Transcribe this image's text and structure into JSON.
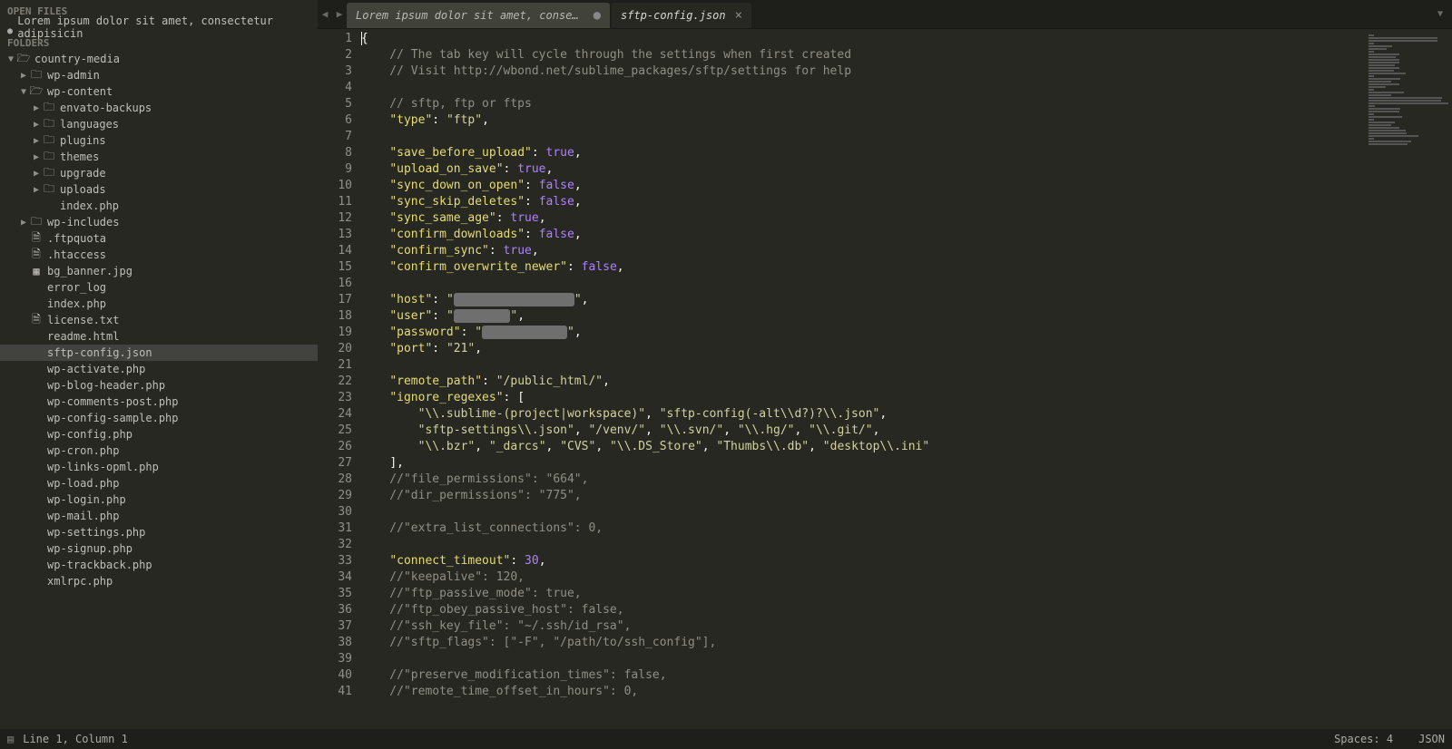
{
  "sidebar": {
    "openFilesLabel": "OPEN FILES",
    "openFiles": [
      {
        "name": "Lorem ipsum dolor sit amet, consectetur adipisicin",
        "dirty": true
      }
    ],
    "foldersLabel": "FOLDERS",
    "tree": [
      {
        "depth": 0,
        "twisty": "open",
        "icon": "folder-open",
        "name": "country-media"
      },
      {
        "depth": 1,
        "twisty": "closed",
        "icon": "folder",
        "name": "wp-admin"
      },
      {
        "depth": 1,
        "twisty": "open",
        "icon": "folder-open",
        "name": "wp-content"
      },
      {
        "depth": 2,
        "twisty": "closed",
        "icon": "folder",
        "name": "envato-backups"
      },
      {
        "depth": 2,
        "twisty": "closed",
        "icon": "folder",
        "name": "languages"
      },
      {
        "depth": 2,
        "twisty": "closed",
        "icon": "folder",
        "name": "plugins"
      },
      {
        "depth": 2,
        "twisty": "closed",
        "icon": "folder",
        "name": "themes"
      },
      {
        "depth": 2,
        "twisty": "closed",
        "icon": "folder",
        "name": "upgrade"
      },
      {
        "depth": 2,
        "twisty": "closed",
        "icon": "folder",
        "name": "uploads"
      },
      {
        "depth": 2,
        "twisty": "none",
        "icon": "none",
        "name": "index.php"
      },
      {
        "depth": 1,
        "twisty": "closed",
        "icon": "folder",
        "name": "wp-includes"
      },
      {
        "depth": 1,
        "twisty": "none",
        "icon": "file",
        "name": ".ftpquota"
      },
      {
        "depth": 1,
        "twisty": "none",
        "icon": "file",
        "name": ".htaccess"
      },
      {
        "depth": 1,
        "twisty": "none",
        "icon": "image",
        "name": "bg_banner.jpg"
      },
      {
        "depth": 1,
        "twisty": "none",
        "icon": "none",
        "name": "error_log"
      },
      {
        "depth": 1,
        "twisty": "none",
        "icon": "none",
        "name": "index.php"
      },
      {
        "depth": 1,
        "twisty": "none",
        "icon": "file",
        "name": "license.txt"
      },
      {
        "depth": 1,
        "twisty": "none",
        "icon": "none",
        "name": "readme.html"
      },
      {
        "depth": 1,
        "twisty": "none",
        "icon": "none",
        "name": "sftp-config.json",
        "selected": true
      },
      {
        "depth": 1,
        "twisty": "none",
        "icon": "none",
        "name": "wp-activate.php"
      },
      {
        "depth": 1,
        "twisty": "none",
        "icon": "none",
        "name": "wp-blog-header.php"
      },
      {
        "depth": 1,
        "twisty": "none",
        "icon": "none",
        "name": "wp-comments-post.php"
      },
      {
        "depth": 1,
        "twisty": "none",
        "icon": "none",
        "name": "wp-config-sample.php"
      },
      {
        "depth": 1,
        "twisty": "none",
        "icon": "none",
        "name": "wp-config.php"
      },
      {
        "depth": 1,
        "twisty": "none",
        "icon": "none",
        "name": "wp-cron.php"
      },
      {
        "depth": 1,
        "twisty": "none",
        "icon": "none",
        "name": "wp-links-opml.php"
      },
      {
        "depth": 1,
        "twisty": "none",
        "icon": "none",
        "name": "wp-load.php"
      },
      {
        "depth": 1,
        "twisty": "none",
        "icon": "none",
        "name": "wp-login.php"
      },
      {
        "depth": 1,
        "twisty": "none",
        "icon": "none",
        "name": "wp-mail.php"
      },
      {
        "depth": 1,
        "twisty": "none",
        "icon": "none",
        "name": "wp-settings.php"
      },
      {
        "depth": 1,
        "twisty": "none",
        "icon": "none",
        "name": "wp-signup.php"
      },
      {
        "depth": 1,
        "twisty": "none",
        "icon": "none",
        "name": "wp-trackback.php"
      },
      {
        "depth": 1,
        "twisty": "none",
        "icon": "none",
        "name": "xmlrpc.php"
      }
    ]
  },
  "tabs": [
    {
      "label": "Lorem ipsum dolor sit amet, consectetur adipisicin",
      "active": false,
      "dirty": true
    },
    {
      "label": "sftp-config.json",
      "active": true,
      "dirty": false
    }
  ],
  "code": {
    "lines": [
      {
        "n": 1,
        "t": "brace_open"
      },
      {
        "n": 2,
        "t": "comment",
        "text": "    // The tab key will cycle through the settings when first created"
      },
      {
        "n": 3,
        "t": "comment",
        "text": "    // Visit http://wbond.net/sublime_packages/sftp/settings for help"
      },
      {
        "n": 4,
        "t": "blank"
      },
      {
        "n": 5,
        "t": "comment",
        "text": "    // sftp, ftp or ftps"
      },
      {
        "n": 6,
        "t": "kv_str",
        "key": "type",
        "val": "ftp",
        "comma": true
      },
      {
        "n": 7,
        "t": "blank"
      },
      {
        "n": 8,
        "t": "kv_bool",
        "key": "save_before_upload",
        "val": "true",
        "comma": true
      },
      {
        "n": 9,
        "t": "kv_bool",
        "key": "upload_on_save",
        "val": "true",
        "comma": true
      },
      {
        "n": 10,
        "t": "kv_bool",
        "key": "sync_down_on_open",
        "val": "false",
        "comma": true
      },
      {
        "n": 11,
        "t": "kv_bool",
        "key": "sync_skip_deletes",
        "val": "false",
        "comma": true
      },
      {
        "n": 12,
        "t": "kv_bool",
        "key": "sync_same_age",
        "val": "true",
        "comma": true
      },
      {
        "n": 13,
        "t": "kv_bool",
        "key": "confirm_downloads",
        "val": "false",
        "comma": true
      },
      {
        "n": 14,
        "t": "kv_bool",
        "key": "confirm_sync",
        "val": "true",
        "comma": true
      },
      {
        "n": 15,
        "t": "kv_bool",
        "key": "confirm_overwrite_newer",
        "val": "false",
        "comma": true
      },
      {
        "n": 16,
        "t": "blank"
      },
      {
        "n": 17,
        "t": "kv_redact",
        "key": "host",
        "w": 17,
        "comma": true
      },
      {
        "n": 18,
        "t": "kv_redact",
        "key": "user",
        "w": 8,
        "comma": true
      },
      {
        "n": 19,
        "t": "kv_redact",
        "key": "password",
        "w": 12,
        "comma": true
      },
      {
        "n": 20,
        "t": "kv_str",
        "key": "port",
        "val": "21",
        "comma": true
      },
      {
        "n": 21,
        "t": "blank"
      },
      {
        "n": 22,
        "t": "kv_str",
        "key": "remote_path",
        "val": "/public_html/",
        "comma": true
      },
      {
        "n": 23,
        "t": "kv_arr_open",
        "key": "ignore_regexes"
      },
      {
        "n": 24,
        "t": "arr_row",
        "items": [
          "\\\\.sublime-(project|workspace)",
          "sftp-config(-alt\\\\d?)?\\\\.json"
        ],
        "trailing": true
      },
      {
        "n": 25,
        "t": "arr_row",
        "items": [
          "sftp-settings\\\\.json",
          "/venv/",
          "\\\\.svn/",
          "\\\\.hg/",
          "\\\\.git/"
        ],
        "trailing": true
      },
      {
        "n": 26,
        "t": "arr_row",
        "items": [
          "\\\\.bzr",
          "_darcs",
          "CVS",
          "\\\\.DS_Store",
          "Thumbs\\\\.db",
          "desktop\\\\.ini"
        ],
        "trailing": false
      },
      {
        "n": 27,
        "t": "arr_close",
        "comma": true
      },
      {
        "n": 28,
        "t": "comment",
        "text": "    //\"file_permissions\": \"664\","
      },
      {
        "n": 29,
        "t": "comment",
        "text": "    //\"dir_permissions\": \"775\","
      },
      {
        "n": 30,
        "t": "blank"
      },
      {
        "n": 31,
        "t": "comment",
        "text": "    //\"extra_list_connections\": 0,"
      },
      {
        "n": 32,
        "t": "blank"
      },
      {
        "n": 33,
        "t": "kv_num",
        "key": "connect_timeout",
        "val": "30",
        "comma": true
      },
      {
        "n": 34,
        "t": "comment",
        "text": "    //\"keepalive\": 120,"
      },
      {
        "n": 35,
        "t": "comment",
        "text": "    //\"ftp_passive_mode\": true,"
      },
      {
        "n": 36,
        "t": "comment",
        "text": "    //\"ftp_obey_passive_host\": false,"
      },
      {
        "n": 37,
        "t": "comment",
        "text": "    //\"ssh_key_file\": \"~/.ssh/id_rsa\","
      },
      {
        "n": 38,
        "t": "comment",
        "text": "    //\"sftp_flags\": [\"-F\", \"/path/to/ssh_config\"],"
      },
      {
        "n": 39,
        "t": "blank"
      },
      {
        "n": 40,
        "t": "comment",
        "text": "    //\"preserve_modification_times\": false,"
      },
      {
        "n": 41,
        "t": "comment",
        "text": "    //\"remote_time_offset_in_hours\": 0,"
      }
    ]
  },
  "status": {
    "position": "Line 1, Column 1",
    "spaces": "Spaces: 4",
    "syntax": "JSON"
  }
}
